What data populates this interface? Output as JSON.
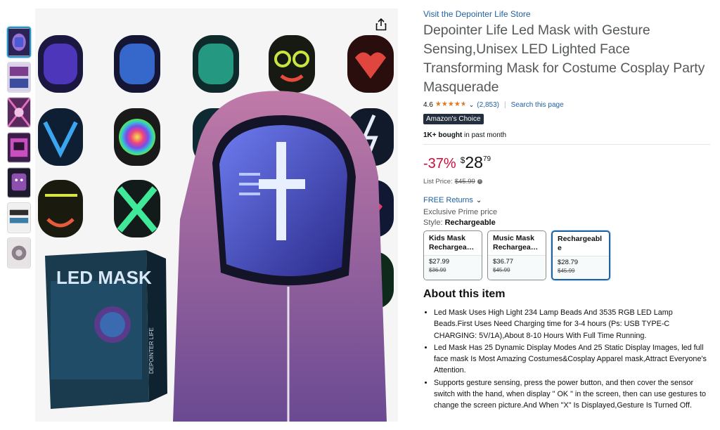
{
  "store": {
    "link_text": "Visit the Depointer Life Store"
  },
  "product": {
    "title": "Depointer Life Led Mask with Gesture Sensing,Unisex LED Lighted Face Transforming Mask for Costume Cosplay Party Masquerade",
    "rating": "4.6",
    "rating_value": 4.6,
    "reviews": "(2,853)",
    "search_link": "Search this page",
    "badge": "Amazon's Choice",
    "bought_bold": "1K+ bought",
    "bought_rest": " in past month",
    "discount": "-37%",
    "currency": "$",
    "price_whole": "28",
    "price_fraction": "79",
    "list_price_label": "List Price:",
    "list_price_value": "$45.99",
    "returns": "FREE Returns",
    "prime_text": "Exclusive Prime price",
    "style_label": "Style:",
    "style_value": "Rechargeable"
  },
  "styles": [
    {
      "name": "Kids Mask Rechargea…",
      "price": "$27.99",
      "old": "$36.99"
    },
    {
      "name": "Music Mask Rechargea…",
      "price": "$36.77",
      "old": "$45.99"
    },
    {
      "name": "Rechargeable",
      "price": "$28.79",
      "old": "$45.99"
    }
  ],
  "about": {
    "heading": "About this item",
    "bullets": [
      "Led Mask Uses High Light 234 Lamp Beads And 3535 RGB LED Lamp Beads.First Uses Need Charging time for 3-4 hours (Ps: USB TYPE-C CHARGING: 5V/1A),About 8-10 Hours With Full Time Running.",
      "Led Mask Has 25 Dynamic Display Modes And 25 Static Display Images, led full face mask Is Most Amazing Costumes&Cosplay Apparel mask,Attract Everyone's Attention.",
      "Supports gesture sensing, press the power button, and then cover the sensor switch with the hand, when display \" OK \" in the screen, then can use gestures to change the screen picture.And When \"X\" Is Displayed,Gesture Is Turned Off."
    ]
  },
  "image": {
    "box_text": "LED MASK",
    "box_brand": "DEPOINTER LIFE"
  },
  "icons": {
    "share": "share-icon",
    "star": "star-icon",
    "chevron": "chevron-down-icon",
    "info": "info-icon"
  },
  "colors": {
    "link": "#2162a1",
    "discount": "#cc0c39",
    "star": "#de7921",
    "badge_bg": "#232f3e",
    "selected_border": "#2162a1"
  }
}
